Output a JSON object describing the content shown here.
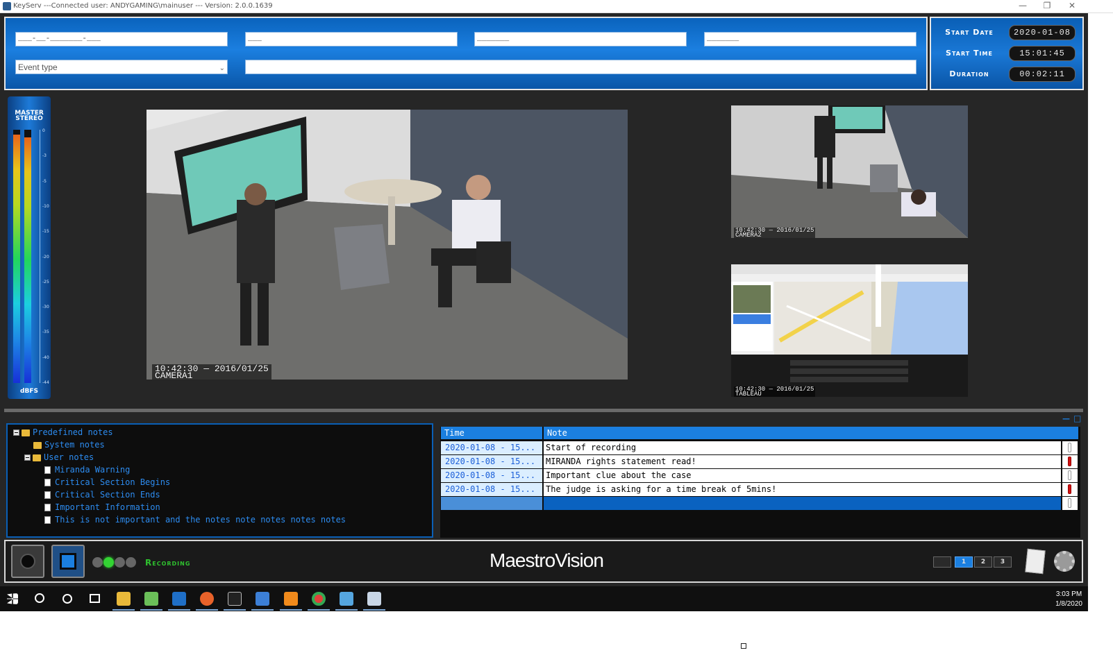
{
  "window": {
    "title": "KeyServ ---Connected user:  ANDYGAMING\\mainuser --- Version:  2.0.0.1639",
    "minimize": "—",
    "maximize": "❐",
    "close": "✕"
  },
  "header": {
    "field1_mask": "___-__-_______-___",
    "field2_mask": "___",
    "field3_mask": "_______",
    "field4_mask": "_______",
    "event_type_placeholder": "Event type",
    "description_value": ""
  },
  "stats": {
    "start_date_label": "Start Date",
    "start_date_value": "2020-01-08",
    "start_time_label": "Start Time",
    "start_time_value": "15:01:45",
    "duration_label": "Duration",
    "duration_value": "00:02:11"
  },
  "vu_meter": {
    "title_line1": "MASTER",
    "title_line2": "STEREO",
    "unit": "dBFS",
    "left_level": 0.98,
    "right_level": 0.97,
    "scale": [
      "0",
      "-3",
      "-5",
      "-10",
      "-15",
      "-20",
      "-25",
      "-30",
      "-35",
      "-40",
      "-44"
    ]
  },
  "feeds": {
    "main_overlay_time": "10:42:30 — 2016/01/25",
    "main_overlay_camera": "CAMERA1",
    "top_right_overlay_time": "10:42:30 — 2016/01/25",
    "top_right_overlay_camera": "CAMERA2",
    "bottom_right_overlay_time": "10:42:30 — 2016/01/25",
    "bottom_right_overlay_camera": "TABLEAU"
  },
  "notes_tree": {
    "root": "Predefined notes",
    "system": "System notes",
    "user": "User notes",
    "items": [
      "Miranda Warning",
      "Critical Section Begins",
      "Critical Section Ends",
      "Important Information",
      "This is not important and the notes note notes notes notes"
    ]
  },
  "notes_table": {
    "columns": [
      "Time",
      "Note"
    ],
    "rows": [
      {
        "time": "2020-01-08 - 15...",
        "note": "Start of recording",
        "flag": "off"
      },
      {
        "time": "2020-01-08 - 15...",
        "note": "MIRANDA rights statement read!",
        "flag": "red"
      },
      {
        "time": "2020-01-08 - 15...",
        "note": "Important clue about the case",
        "flag": "off"
      },
      {
        "time": "2020-01-08 - 15...",
        "note": "The judge is asking for a time break of 5mins!",
        "flag": "red"
      }
    ],
    "panel_minimize": "—",
    "panel_maximize": "□"
  },
  "toolbar": {
    "recording_label": "Recording",
    "brand": "MaestroVision",
    "layout_buttons": [
      "",
      "1",
      "2",
      "3"
    ]
  },
  "taskbar": {
    "time": "3:03 PM",
    "date": "1/8/2020"
  },
  "colors": {
    "accent_blue": "#1b7fe0",
    "recording_green": "#2fc12f",
    "flag_red": "#d01010"
  },
  "icons": [
    "app-icon",
    "windows-start-icon",
    "search-icon",
    "cortana-icon",
    "task-view-icon",
    "file-explorer-icon",
    "notepad-icon",
    "outlook-icon",
    "firefox-icon",
    "terminal-icon",
    "visual-studio-icon",
    "sublime-icon",
    "chrome-icon",
    "keyserv-icon",
    "maestro-icon",
    "gear-icon",
    "notes-icon",
    "record-icon",
    "stop-icon",
    "folder-icon",
    "document-icon",
    "flag-icon"
  ]
}
